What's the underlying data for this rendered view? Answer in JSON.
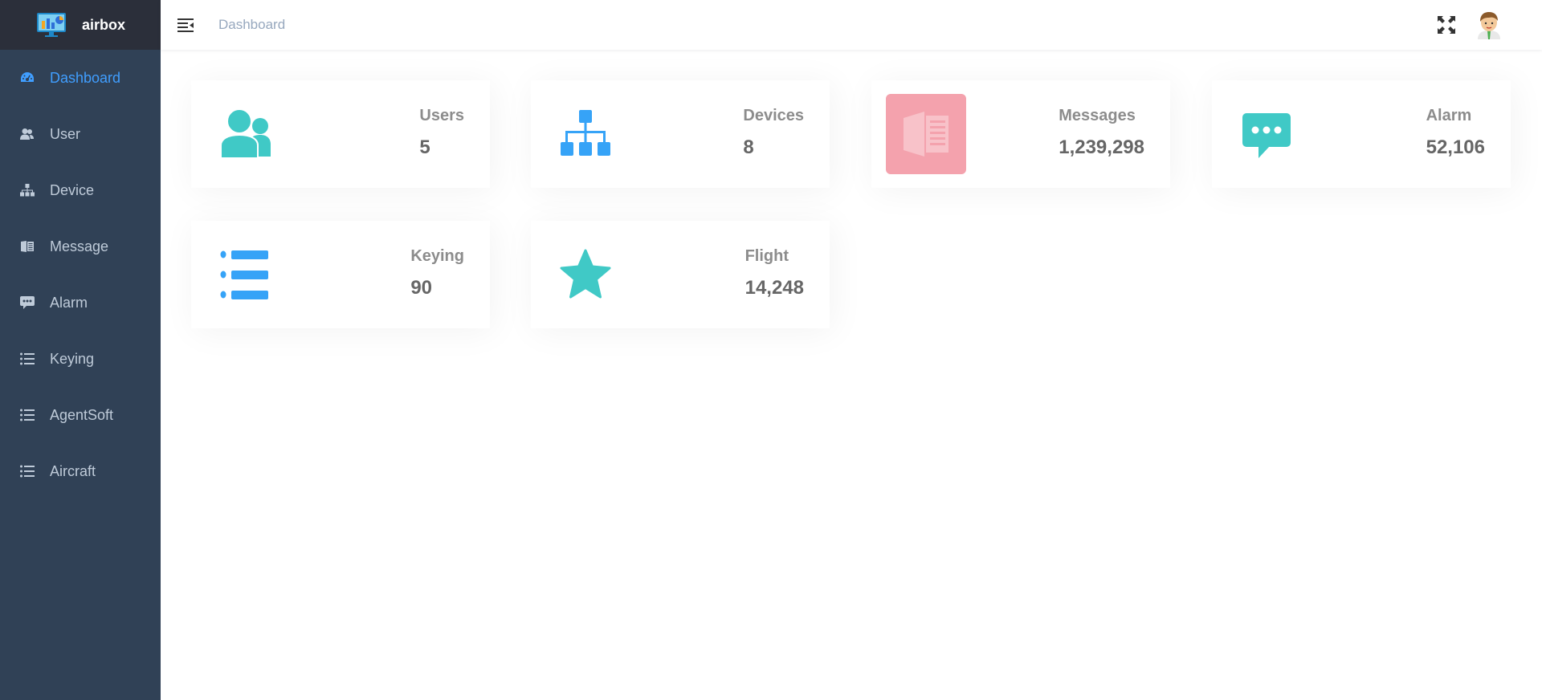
{
  "app": {
    "name": "airbox"
  },
  "header": {
    "breadcrumb": "Dashboard"
  },
  "sidebar": {
    "items": [
      {
        "label": "Dashboard",
        "icon": "dashboard-icon",
        "active": true
      },
      {
        "label": "User",
        "icon": "user-icon"
      },
      {
        "label": "Device",
        "icon": "tree-icon"
      },
      {
        "label": "Message",
        "icon": "message-icon"
      },
      {
        "label": "Alarm",
        "icon": "chat-icon"
      },
      {
        "label": "Keying",
        "icon": "list-icon"
      },
      {
        "label": "AgentSoft",
        "icon": "list-icon"
      },
      {
        "label": "Aircraft",
        "icon": "list-icon"
      }
    ]
  },
  "panels": [
    {
      "label": "Users",
      "value": "5",
      "icon": "peoples-icon",
      "color": "#40c9c6"
    },
    {
      "label": "Devices",
      "value": "8",
      "icon": "tree-icon",
      "color": "#36a3f7"
    },
    {
      "label": "Messages",
      "value": "1,239,298",
      "icon": "message-icon",
      "color": "#f4516c"
    },
    {
      "label": "Alarm",
      "value": "52,106",
      "icon": "chat-icon",
      "color": "#40c9c6"
    },
    {
      "label": "Keying",
      "value": "90",
      "icon": "list-icon",
      "color": "#36a3f7"
    },
    {
      "label": "Flight",
      "value": "14,248",
      "icon": "star-icon",
      "color": "#40c9c6"
    }
  ],
  "colors": {
    "sidebar_bg": "#304156",
    "logo_bg": "#2b2f3a",
    "active": "#409eff",
    "menu_text": "#bfcbd9"
  }
}
